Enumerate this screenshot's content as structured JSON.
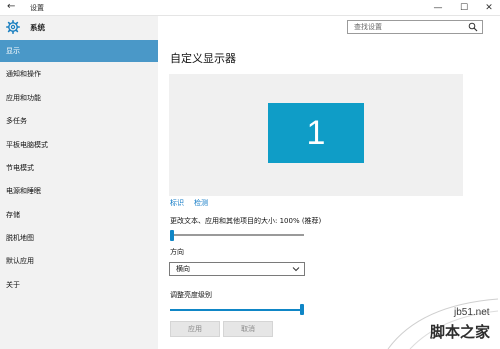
{
  "window": {
    "back_glyph": "←",
    "title": "设置",
    "minimize_glyph": "—",
    "maximize_glyph": "☐",
    "close_glyph": "✕"
  },
  "header": {
    "app_title": "系统",
    "search_placeholder": "查找设置"
  },
  "sidebar": {
    "items": [
      {
        "label": "显示",
        "active": true
      },
      {
        "label": "通知和操作"
      },
      {
        "label": "应用和功能"
      },
      {
        "label": "多任务"
      },
      {
        "label": "平板电脑模式"
      },
      {
        "label": "节电模式"
      },
      {
        "label": "电源和睡眠"
      },
      {
        "label": "存储"
      },
      {
        "label": "脱机地图"
      },
      {
        "label": "默认应用"
      },
      {
        "label": "关于"
      }
    ]
  },
  "main": {
    "title": "自定义显示器",
    "monitor_number": "1",
    "identify_link": "标识",
    "detect_link": "检测",
    "scale_label": "更改文本、应用和其他项目的大小: 100% (推荐)",
    "scale_level": 0,
    "orientation_label": "方向",
    "orientation_value": "横向",
    "brightness_label": "调整亮度级别",
    "brightness_level": 1,
    "apply_button": "应用",
    "cancel_button": "取消"
  },
  "watermark": {
    "url": "jb51.net",
    "brand": "脚本之家"
  },
  "colors": {
    "accent": "#0f86c6",
    "selected_nav": "#4a98c8",
    "monitor": "#0f9dc7",
    "link": "#0c77c4"
  }
}
